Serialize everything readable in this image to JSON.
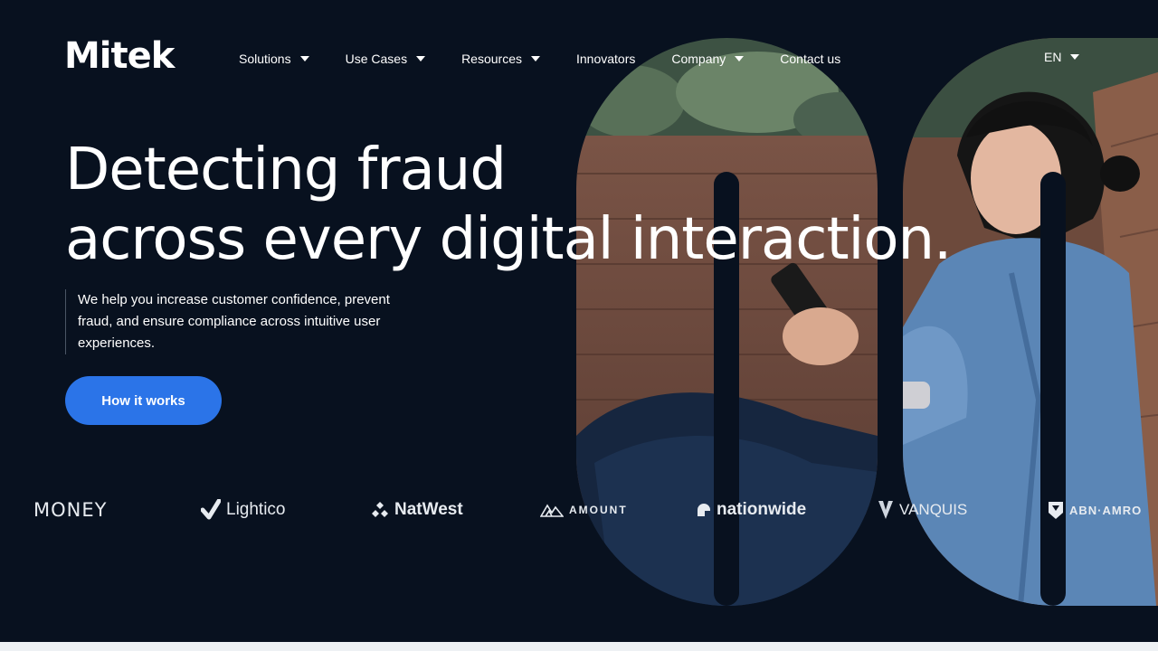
{
  "brand": {
    "logo_text": "Mitek",
    "accent": "#e5173f"
  },
  "nav": {
    "items": [
      {
        "label": "Solutions",
        "has_dropdown": true
      },
      {
        "label": "Use Cases",
        "has_dropdown": true
      },
      {
        "label": "Resources",
        "has_dropdown": true
      },
      {
        "label": "Innovators",
        "has_dropdown": false
      },
      {
        "label": "Company",
        "has_dropdown": true
      },
      {
        "label": "Contact us",
        "has_dropdown": false
      }
    ],
    "language": "EN"
  },
  "hero": {
    "headline_line1": "Detecting fraud",
    "headline_line2": "across every digital interaction.",
    "subtext": "We help you increase customer confidence, prevent fraud, and ensure compliance across intuitive user experiences.",
    "cta_label": "How it works",
    "cta_color": "#2b74e8",
    "background": "#08111f"
  },
  "partners": [
    {
      "name": "MONEY",
      "icon": "virgin-money-logo"
    },
    {
      "name": "Lightico",
      "icon": "lightico-check-icon"
    },
    {
      "name": "NatWest",
      "icon": "natwest-cubes-icon"
    },
    {
      "name": "AMOUNT",
      "icon": "amount-mountain-icon"
    },
    {
      "name": "nationwide",
      "icon": "nationwide-roof-icon"
    },
    {
      "name": "VANQUIS",
      "icon": "vanquis-v-icon"
    },
    {
      "name": "ABN·AMRO",
      "icon": "abn-amro-shield-icon"
    }
  ]
}
